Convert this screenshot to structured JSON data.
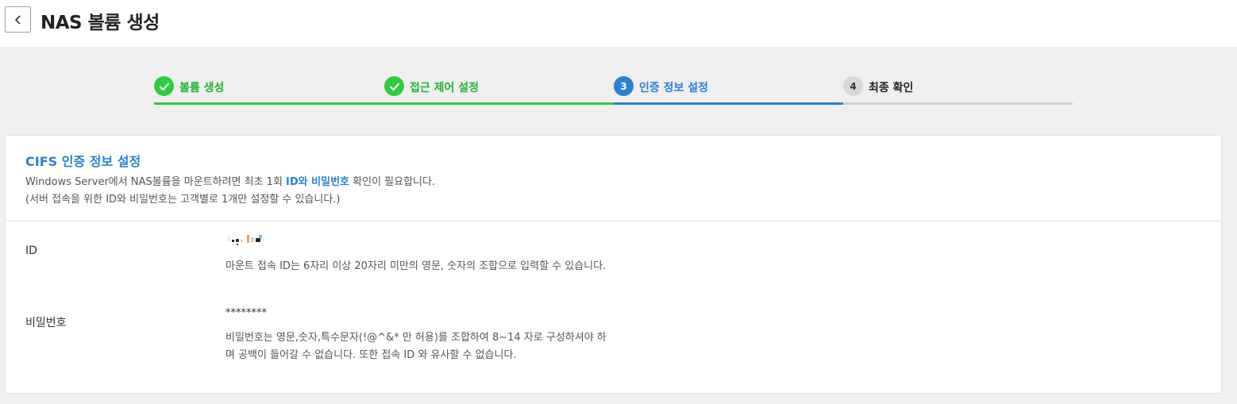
{
  "header": {
    "title": "NAS 볼륨 생성",
    "back_icon": "chevron-left-icon"
  },
  "stepper": {
    "steps": [
      {
        "label": "볼륨 생성",
        "status": "done",
        "marker": ""
      },
      {
        "label": "접근 제어 설정",
        "status": "done",
        "marker": ""
      },
      {
        "label": "인증 정보 설정",
        "status": "active",
        "marker": "3"
      },
      {
        "label": "최종 확인",
        "status": "todo",
        "marker": "4"
      }
    ],
    "colors": {
      "done": "#2ecc40",
      "active": "#2b7fd1",
      "todo": "#d7d7d7"
    }
  },
  "section": {
    "title": "CIFS 인증 정보 설정",
    "desc_line1_pre": "Windows Server에서 NAS볼륨을 마운트하려면 최초 1회 ",
    "desc_line1_highlight": "ID와 비밀번호",
    "desc_line1_post": " 확인이 필요합니다.",
    "desc_line2": "(서버 접속을 위한 ID와 비밀번호는 고객별로 1개만 설정할 수 있습니다.)"
  },
  "fields": {
    "id": {
      "label": "ID",
      "help": "마운트 접속 ID는 6자리 이상 20자리 미만의 영문, 숫자의 조합으로 입력할 수 있습니다."
    },
    "password": {
      "label": "비밀번호",
      "value": "********",
      "help": "비밀번호는 영문,숫자,특수문자(!@^&* 만 허용)를 조합하여 8~14 자로 구성하셔야 하며 공백이 들어갈 수 없습니다. 또한 접속 ID 와 유사할 수 없습니다."
    }
  }
}
